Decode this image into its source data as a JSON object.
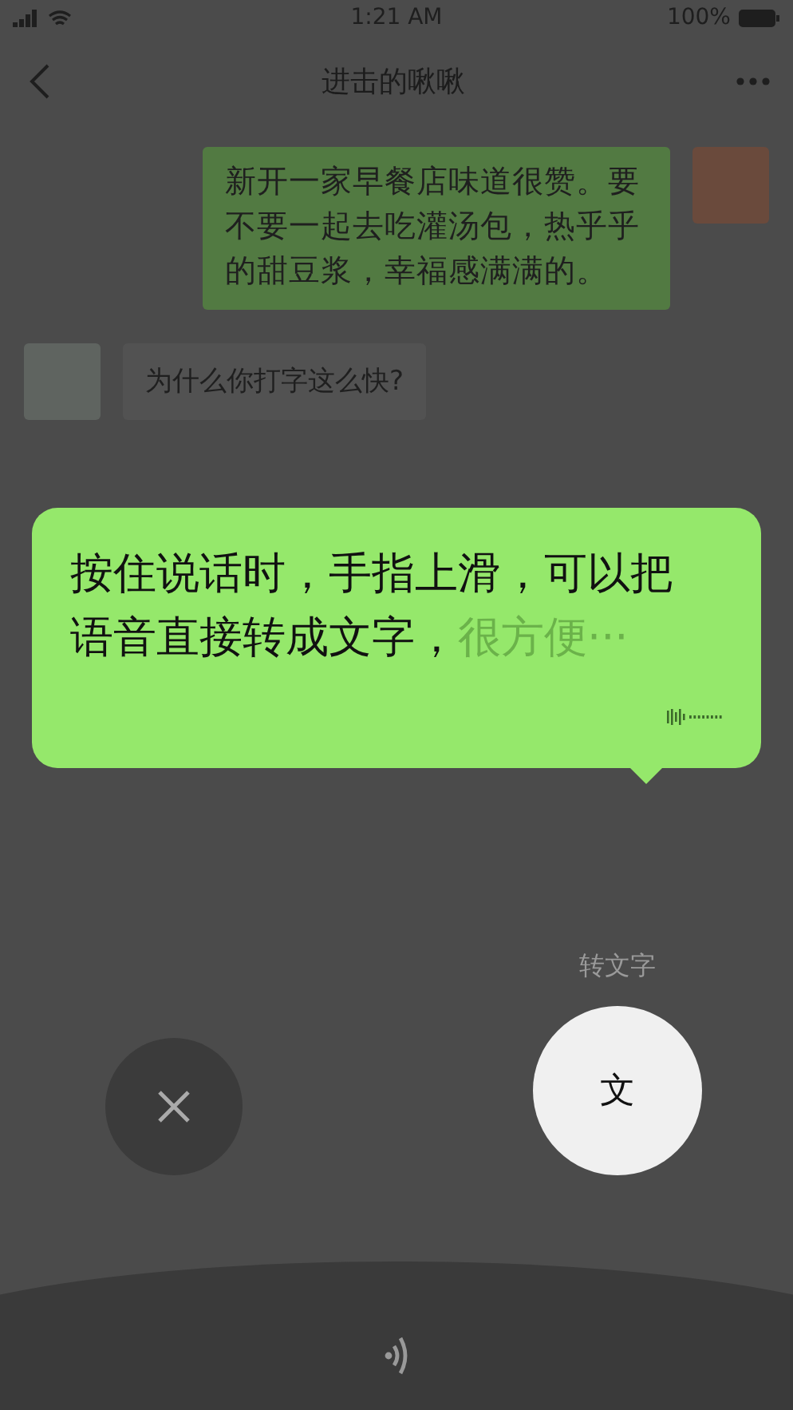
{
  "status_bar": {
    "time": "1:21 AM",
    "battery": "100%"
  },
  "nav": {
    "title": "进击的啾啾"
  },
  "messages": [
    {
      "kind": "sent",
      "text": "新开一家早餐店味道很赞。要不要一起去吃灌汤包，热乎乎的甜豆浆，幸福感满满的。"
    },
    {
      "kind": "received",
      "text": "为什么你打字这么快?"
    }
  ],
  "voice_bubble": {
    "recognized_lines": [
      "按住说话时，手指上滑，可以把",
      "语音直接转成文字，"
    ],
    "pending_text": "很方便···"
  },
  "options": [
    {
      "kind": "cancel",
      "selected": false
    },
    {
      "kind": "convert",
      "label": "文",
      "caption": "转文字",
      "selected": true
    }
  ]
}
